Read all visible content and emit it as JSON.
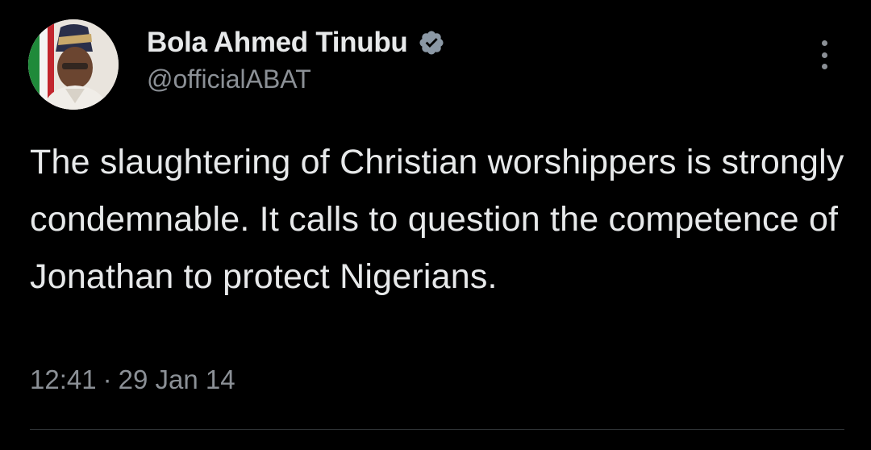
{
  "author": {
    "display_name": "Bola Ahmed Tinubu",
    "handle": "@officialABAT",
    "verified": true
  },
  "tweet": {
    "text": "The slaughtering of Christian worshippers is strongly condemnable. It calls to question the competence of Jonathan to protect Nigerians.",
    "time": "12:41",
    "separator": "·",
    "date": "29 Jan 14"
  },
  "icons": {
    "verified": "verified-badge-icon",
    "more": "more-options-icon"
  },
  "colors": {
    "background": "#000000",
    "text_primary": "#e7e9ea",
    "text_secondary": "#8b9096",
    "verified_badge": "#8b98a5",
    "divider": "#2f3336"
  }
}
